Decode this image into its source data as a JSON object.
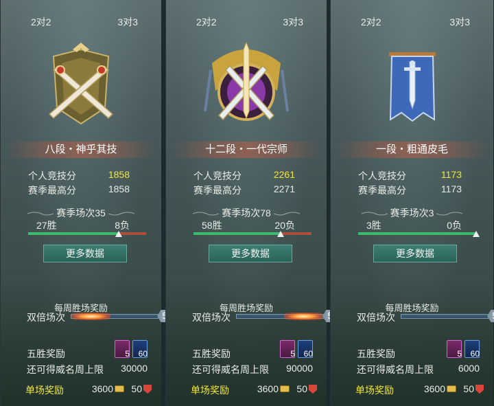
{
  "panels": [
    {
      "tab_left": "2对2",
      "tab_right": "3对3",
      "emblem_icon": "crossed-swords-emblem-icon",
      "rank_name": "八段・神乎其技",
      "personal_score_label": "个人竞技分",
      "personal_score": "1858",
      "season_high_label": "赛季最高分",
      "season_high": "1858",
      "season_matches": "赛季场次35",
      "wins": "27胜",
      "losses": "8负",
      "win_ratio": 0.77,
      "more_button": "更多数据",
      "weekly_reward_title": "每周胜场奖励",
      "double_label": "双倍场次",
      "double_count": "5",
      "double_progress": 0.12,
      "five_win_label": "五胜奖励",
      "item1_count": "5",
      "item2_count": "60",
      "limit_label": "还可得威名周上限",
      "limit_value": "30000",
      "single_label": "单场奖励",
      "single_coins": "3600",
      "single_shield": "50"
    },
    {
      "tab_left": "2对2",
      "tab_right": "3对3",
      "emblem_icon": "grandmaster-emblem-icon",
      "rank_name": "十二段・一代宗师",
      "personal_score_label": "个人竞技分",
      "personal_score": "2261",
      "season_high_label": "赛季最高分",
      "season_high": "2271",
      "season_matches": "赛季场次78",
      "wins": "58胜",
      "losses": "20负",
      "win_ratio": 0.74,
      "more_button": "更多数据",
      "weekly_reward_title": "每周胜场奖励",
      "double_label": "双倍场次",
      "double_count": "5",
      "double_progress": 0.85,
      "five_win_label": "五胜奖励",
      "item1_count": "5",
      "item2_count": "60",
      "limit_label": "还可得威名周上限",
      "limit_value": "90000",
      "single_label": "单场奖励",
      "single_coins": "3600",
      "single_shield": "50"
    },
    {
      "tab_left": "2对2",
      "tab_right": "3对3",
      "emblem_icon": "banner-sword-emblem-icon",
      "rank_name": "一段・粗通皮毛",
      "personal_score_label": "个人竞技分",
      "personal_score": "1173",
      "season_high_label": "赛季最高分",
      "season_high": "1173",
      "season_matches": "赛季场次3",
      "wins": "3胜",
      "losses": "0负",
      "win_ratio": 1.0,
      "more_button": "更多数据",
      "weekly_reward_title": "每周胜场奖励",
      "double_label": "双倍场次",
      "double_count": "5",
      "double_progress": 0.0,
      "five_win_label": "五胜奖励",
      "item1_count": "5",
      "item2_count": "60",
      "limit_label": "还可得威名周上限",
      "limit_value": "6000",
      "single_label": "单场奖励",
      "single_coins": "3600",
      "single_shield": "50"
    }
  ]
}
